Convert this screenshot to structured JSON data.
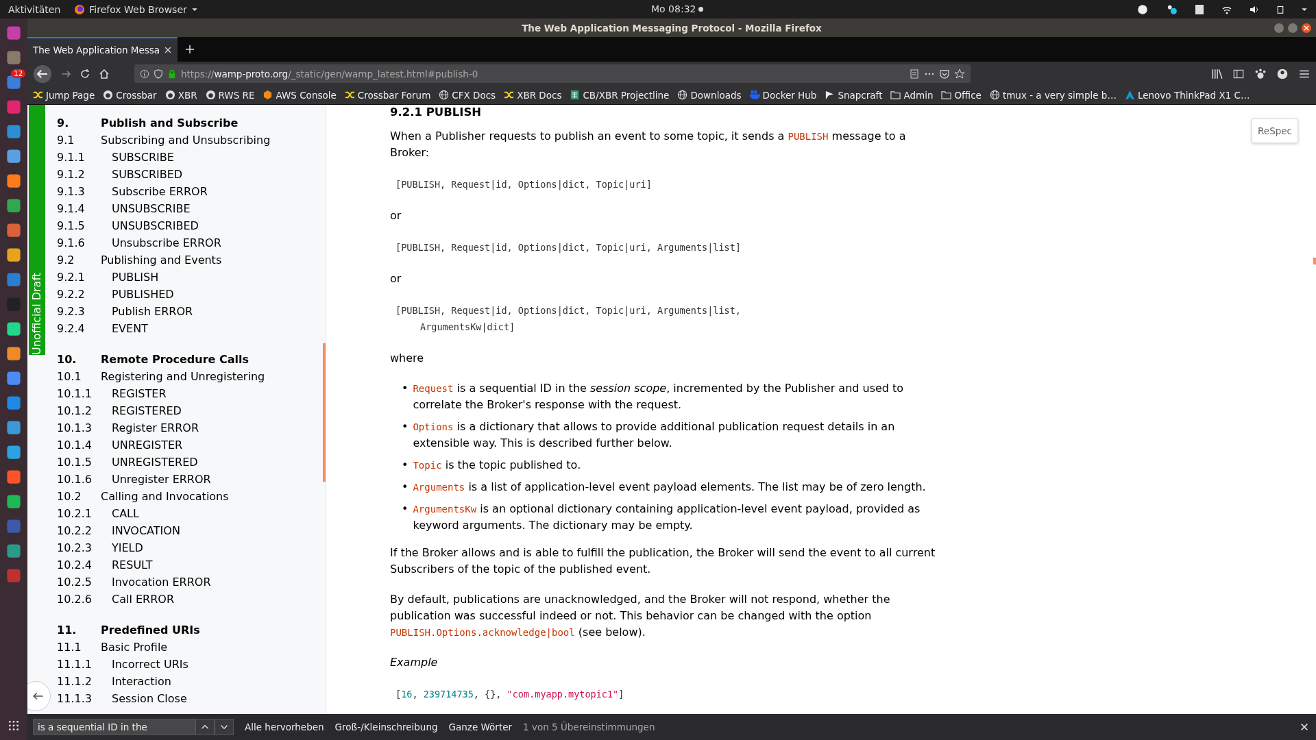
{
  "top_bar": {
    "activities": "Aktivitäten",
    "app_menu": "Firefox Web Browser",
    "clock": "Mo 08:32"
  },
  "dock": {
    "badge": "12"
  },
  "window": {
    "title": "The Web Application Messaging Protocol - Mozilla Firefox"
  },
  "tabs": [
    {
      "label": "The Web Application Messa",
      "selected": true
    }
  ],
  "url": {
    "scheme": "https://",
    "host": "wamp-proto.org",
    "path": "/_static/gen/wamp_latest.html#publish-0"
  },
  "bookmarks": [
    {
      "label": "Jump Page",
      "kind": "crossbar"
    },
    {
      "label": "Crossbar",
      "kind": "github"
    },
    {
      "label": "XBR",
      "kind": "github"
    },
    {
      "label": "RWS RE",
      "kind": "github"
    },
    {
      "label": "AWS Console",
      "kind": "cube"
    },
    {
      "label": "Crossbar Forum",
      "kind": "crossbar"
    },
    {
      "label": "CFX Docs",
      "kind": "globe"
    },
    {
      "label": "XBR Docs",
      "kind": "crossbar"
    },
    {
      "label": "CB/XBR Projectline",
      "kind": "sheet"
    },
    {
      "label": "Downloads",
      "kind": "globe"
    },
    {
      "label": "Docker Hub",
      "kind": "whale"
    },
    {
      "label": "Snapcraft",
      "kind": "snap"
    },
    {
      "label": "Admin",
      "kind": "folder"
    },
    {
      "label": "Office",
      "kind": "folder"
    },
    {
      "label": "tmux - a very simple b…",
      "kind": "globe"
    },
    {
      "label": "Lenovo ThinkPad X1 C…",
      "kind": "arch"
    }
  ],
  "toc": {
    "label": "Unofficial Draft",
    "items": [
      {
        "number": "9.",
        "title": "Publish and Subscribe",
        "children": [
          {
            "number": "9.1",
            "title": "Subscribing and Unsubscribing",
            "children": [
              {
                "number": "9.1.1",
                "title": "SUBSCRIBE"
              },
              {
                "number": "9.1.2",
                "title": "SUBSCRIBED"
              },
              {
                "number": "9.1.3",
                "title": "Subscribe ERROR"
              },
              {
                "number": "9.1.4",
                "title": "UNSUBSCRIBE"
              },
              {
                "number": "9.1.5",
                "title": "UNSUBSCRIBED"
              },
              {
                "number": "9.1.6",
                "title": "Unsubscribe ERROR"
              }
            ]
          },
          {
            "number": "9.2",
            "title": "Publishing and Events",
            "children": [
              {
                "number": "9.2.1",
                "title": "PUBLISH"
              },
              {
                "number": "9.2.2",
                "title": "PUBLISHED"
              },
              {
                "number": "9.2.3",
                "title": "Publish ERROR"
              },
              {
                "number": "9.2.4",
                "title": "EVENT"
              }
            ]
          }
        ]
      },
      {
        "number": "10.",
        "title": "Remote Procedure Calls",
        "children": [
          {
            "number": "10.1",
            "title": "Registering and Unregistering",
            "children": [
              {
                "number": "10.1.1",
                "title": "REGISTER"
              },
              {
                "number": "10.1.2",
                "title": "REGISTERED"
              },
              {
                "number": "10.1.3",
                "title": "Register ERROR"
              },
              {
                "number": "10.1.4",
                "title": "UNREGISTER"
              },
              {
                "number": "10.1.5",
                "title": "UNREGISTERED"
              },
              {
                "number": "10.1.6",
                "title": "Unregister ERROR"
              }
            ]
          },
          {
            "number": "10.2",
            "title": "Calling and Invocations",
            "children": [
              {
                "number": "10.2.1",
                "title": "CALL"
              },
              {
                "number": "10.2.2",
                "title": "INVOCATION"
              },
              {
                "number": "10.2.3",
                "title": "YIELD"
              },
              {
                "number": "10.2.4",
                "title": "RESULT"
              },
              {
                "number": "10.2.5",
                "title": "Invocation ERROR"
              },
              {
                "number": "10.2.6",
                "title": "Call ERROR"
              }
            ]
          }
        ]
      },
      {
        "number": "11.",
        "title": "Predefined URIs",
        "children": [
          {
            "number": "11.1",
            "title": "Basic Profile",
            "children": [
              {
                "number": "11.1.1",
                "title": "Incorrect URIs"
              },
              {
                "number": "11.1.2",
                "title": "Interaction"
              },
              {
                "number": "11.1.3",
                "title": "Session Close"
              }
            ]
          }
        ]
      }
    ]
  },
  "respec_button": "ReSpec",
  "content": [
    {
      "kind": "heading",
      "text": "9.2.1 PUBLISH"
    },
    {
      "kind": "para",
      "segments": [
        {
          "text": "When a Publisher requests to publish an event to some topic, it sends a ",
          "kind": "text"
        },
        {
          "text": "PUBLISH",
          "kind": "code"
        },
        {
          "text": " message to a Broker:",
          "kind": "text"
        }
      ]
    },
    {
      "kind": "code",
      "lines": [
        [
          {
            "text": "[PUBLISH, Request|id, Options|dict, Topic|uri]",
            "kind": "plain"
          }
        ]
      ]
    },
    {
      "kind": "para",
      "segments": [
        {
          "text": "or",
          "kind": "text"
        }
      ]
    },
    {
      "kind": "code",
      "lines": [
        [
          {
            "text": "[PUBLISH, Request|id, Options|dict, Topic|uri, Arguments|list]",
            "kind": "plain"
          }
        ]
      ]
    },
    {
      "kind": "para",
      "segments": [
        {
          "text": "or",
          "kind": "text"
        }
      ]
    },
    {
      "kind": "code",
      "lines": [
        [
          {
            "text": "[PUBLISH, Request|id, Options|dict, Topic|uri, Arguments|list,",
            "kind": "plain"
          }
        ],
        [
          {
            "text": "ArgumentsKw|dict]",
            "kind": "plain"
          }
        ]
      ]
    },
    {
      "kind": "para",
      "segments": [
        {
          "text": "where",
          "kind": "text"
        }
      ]
    },
    {
      "kind": "list",
      "marker": "•",
      "items": [
        [
          {
            "text": "Request",
            "kind": "code"
          },
          {
            "text": " is a sequential ID in the ",
            "kind": "text"
          },
          {
            "text": "session scope",
            "kind": "em"
          },
          {
            "text": ", incremented by the Publisher and used to correlate the Broker's response with the request.",
            "kind": "text"
          }
        ],
        [
          {
            "text": "Options",
            "kind": "code"
          },
          {
            "text": " is a dictionary that allows to provide additional publication request details in an extensible way. This is described further below.",
            "kind": "text"
          }
        ],
        [
          {
            "text": "Topic",
            "kind": "code"
          },
          {
            "text": " is the topic published to.",
            "kind": "text"
          }
        ],
        [
          {
            "text": "Arguments",
            "kind": "code"
          },
          {
            "text": " is a list of application-level event payload elements. The list may be of zero length.",
            "kind": "text"
          }
        ],
        [
          {
            "text": "ArgumentsKw",
            "kind": "code"
          },
          {
            "text": " is an optional dictionary containing application-level event payload, provided as keyword arguments. The dictionary may be empty.",
            "kind": "text"
          }
        ]
      ]
    },
    {
      "kind": "para",
      "segments": [
        {
          "text": "If the Broker allows and is able to fulfill the publication, the Broker will send the event to all current Subscribers of the topic of the published event.",
          "kind": "text"
        }
      ]
    },
    {
      "kind": "para",
      "segments": [
        {
          "text": "By default, publications are unacknowledged, and the Broker will not respond, whether the publication was successful indeed or not. This behavior can be changed with the option ",
          "kind": "text"
        },
        {
          "text": "PUBLISH.Options.acknowledge|bool",
          "kind": "code"
        },
        {
          "text": " (see below).",
          "kind": "text"
        }
      ]
    },
    {
      "kind": "caption",
      "text": "Example"
    },
    {
      "kind": "code",
      "lines": [
        [
          {
            "text": "[",
            "kind": "plain"
          },
          {
            "text": "16",
            "kind": "number"
          },
          {
            "text": ", ",
            "kind": "plain"
          },
          {
            "text": "239714735",
            "kind": "number"
          },
          {
            "text": ", {}, ",
            "kind": "plain"
          },
          {
            "text": "\"com.myapp.mytopic1\"",
            "kind": "string"
          },
          {
            "text": "]",
            "kind": "plain"
          }
        ]
      ]
    }
  ],
  "find_bar": {
    "value": "is a sequential ID in the",
    "options": [
      "Alle hervorheben",
      "Groß-/Kleinschreibung",
      "Ganze Wörter"
    ],
    "status": "1 von 5 Übereinstimmungen"
  }
}
